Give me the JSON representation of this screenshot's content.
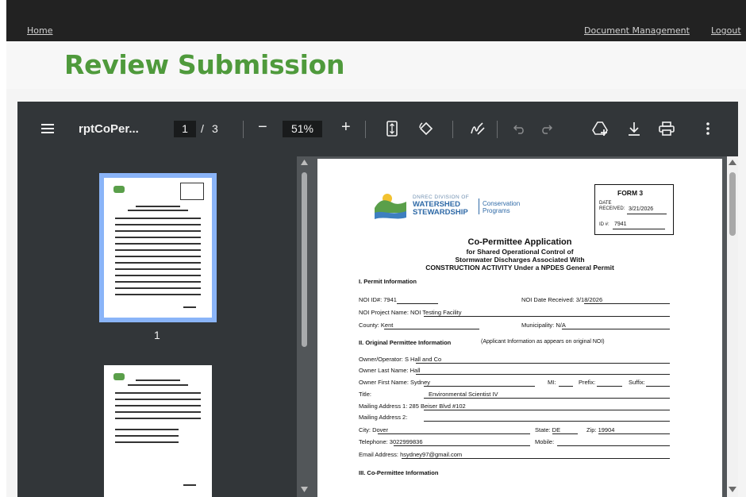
{
  "nav": {
    "home": "Home",
    "document_management": "Document Management",
    "logout": "Logout"
  },
  "page_title": "Review Submission",
  "pdf_toolbar": {
    "filename": "rptCoPer...",
    "current_page": "1",
    "page_sep": "/",
    "total_pages": "3",
    "zoom": "51%",
    "zoom_out": "−",
    "zoom_in": "+"
  },
  "thumbnails": [
    {
      "label": "1",
      "selected": true
    },
    {
      "label": "",
      "selected": false
    }
  ],
  "document": {
    "org_line1": "DNREC DIVISION OF",
    "org_line2": "WATERSHED",
    "org_line3": "STEWARDSHIP",
    "program_line1": "Conservation",
    "program_line2": "Programs",
    "form_title": "FORM 3",
    "date_received_label": "DATE RECEIVED:",
    "date_received": "3/21/2026",
    "id_label": "ID #:",
    "id_value": "7941",
    "heading": "Co-Permittee Application",
    "subheading1": "for Shared Operational Control of",
    "subheading2": "Stormwater Discharges Associated With",
    "subheading3": "CONSTRUCTION ACTIVITY Under a NPDES General Permit",
    "section1": "I. Permit Information",
    "noi_id": "NOI ID#:  7941",
    "noi_date": "NOI Date Received:  3/18/2026",
    "project_name": "NOI Project Name:  NOI Testing Facility",
    "county": "County:  Kent",
    "municipality": "Municipality:  N/A",
    "section2": "II. Original Permittee Information",
    "section2_note": "(Applicant Information as appears on original NOI)",
    "owner_operator": "Owner/Operator:   S Hall and Co",
    "owner_last": "Owner Last Name:  Hall",
    "owner_first": "Owner First Name:  Sydney",
    "mi": "MI:",
    "prefix": "Prefix:",
    "suffix": "Suffix:",
    "title_label": "Title:",
    "title_value": "Environmental Scientist IV",
    "address1": "Mailing Address 1:  285 Beiser Blvd #102",
    "address2": "Mailing Address 2:",
    "city": "City:  Dover",
    "state": "State:  DE",
    "zip": "Zip:  19904",
    "telephone": "Telephone:  3022999836",
    "mobile": "Mobile:",
    "email": "Email Address:  hsydney97@gmail.com",
    "section3": "III. Co-Permittee Information"
  },
  "colors": {
    "title_green": "#4f9a3c",
    "toolbar_bg": "#323639",
    "viewer_bg": "#525659",
    "thumb_selected": "#8ab4f8"
  }
}
